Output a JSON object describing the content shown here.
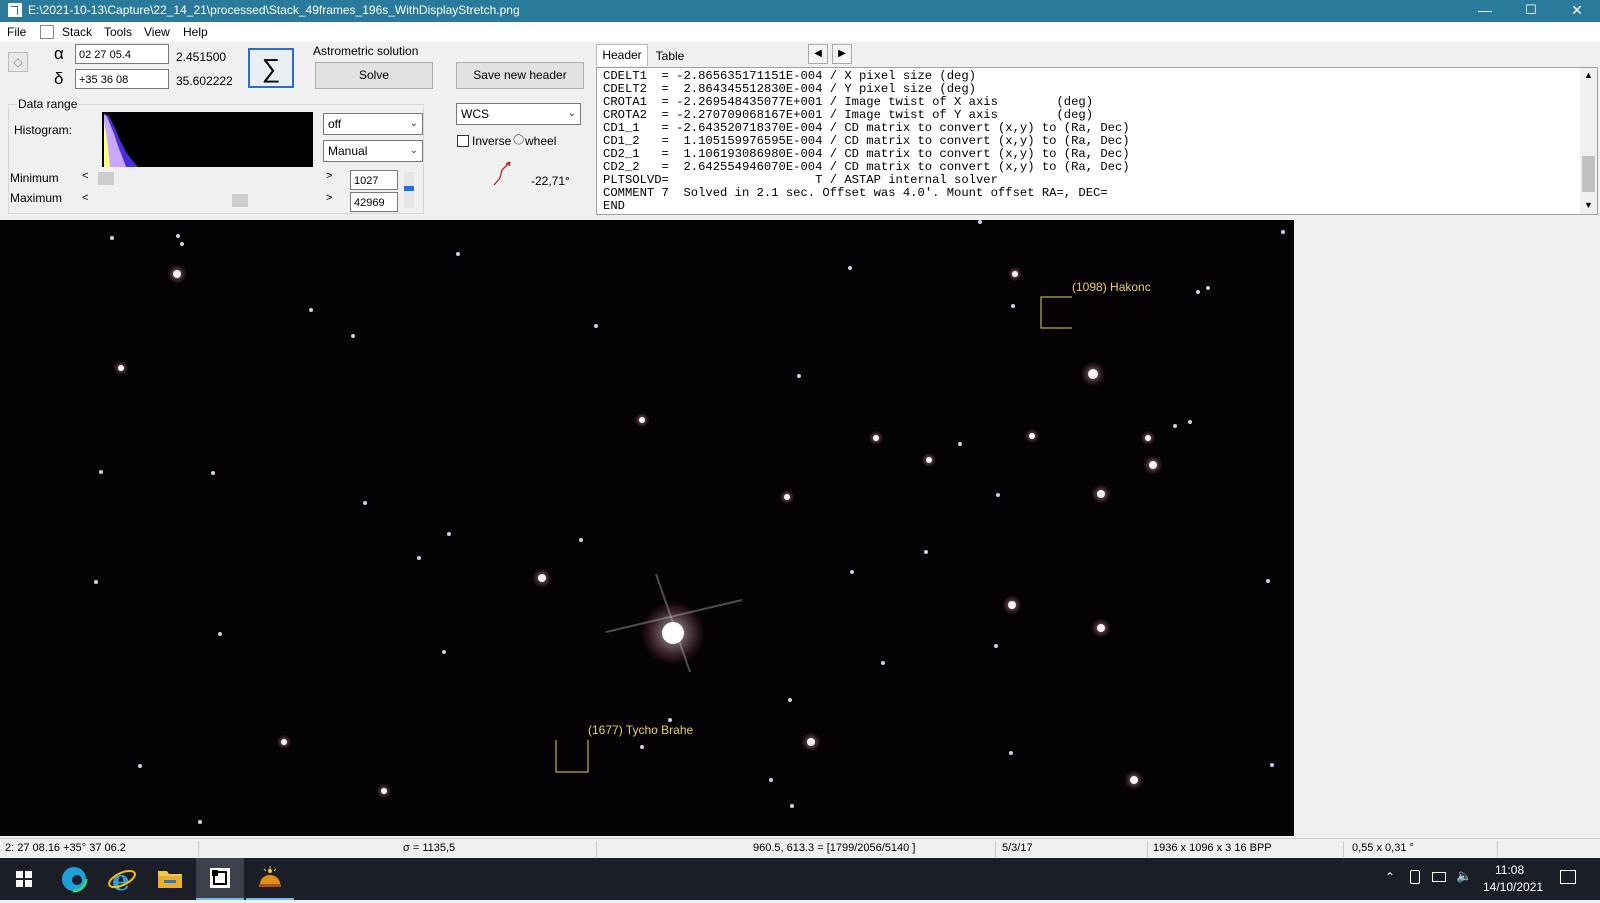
{
  "window": {
    "title": "E:\\2021-10-13\\Capture\\22_14_21\\processed\\Stack_49frames_196s_WithDisplayStretch.png",
    "minimize_glyph": "—",
    "maximize_glyph": "☐",
    "close_glyph": "✕"
  },
  "menu": {
    "file": "File",
    "stack": "Stack",
    "tools": "Tools",
    "view": "View",
    "help": "Help"
  },
  "coords": {
    "alpha_symbol": "α",
    "alpha_value": "02 27 05.4",
    "alpha_decimal": "2.451500",
    "delta_symbol": "δ",
    "delta_value": "+35 36 08",
    "delta_decimal": "35.602222",
    "sum_symbol": "∑"
  },
  "astrometric": {
    "label": "Astrometric solution",
    "solve": "Solve",
    "save_header": "Save new header"
  },
  "data_range": {
    "label": "Data range",
    "histogram_label": "Histogram:",
    "minimum_label": "Minimum",
    "maximum_label": "Maximum",
    "minimum_value": "1027",
    "maximum_value": "42969",
    "stretch": "off",
    "range_mode": "Manual"
  },
  "wcs": {
    "mode": "WCS",
    "inverse_label": "Inverse",
    "wheel_label": "wheel",
    "angle": "-22,71°"
  },
  "tabs": {
    "header": "Header",
    "table": "Table"
  },
  "header_lines": [
    "CDELT1  = -2.865635171151E-004 / X pixel size (deg)",
    "CDELT2  =  2.864345512830E-004 / Y pixel size (deg)",
    "CROTA1  = -2.269548435077E+001 / Image twist of X axis        (deg)",
    "CROTA2  = -2.270709068167E+001 / Image twist of Y axis        (deg)",
    "CD1_1   = -2.643520718370E-004 / CD matrix to convert (x,y) to (Ra, Dec)",
    "CD1_2   =  1.105159976595E-004 / CD matrix to convert (x,y) to (Ra, Dec)",
    "CD2_1   =  1.106193086980E-004 / CD matrix to convert (x,y) to (Ra, Dec)",
    "CD2_2   =  2.642554946070E-004 / CD matrix to convert (x,y) to (Ra, Dec)",
    "PLTSOLVD=                    T / ASTAP internal solver",
    "COMMENT 7  Solved in 2.1 sec. Offset was 4.0'. Mount offset RA=, DEC=",
    "END"
  ],
  "annotations": {
    "asteroid1": "(1098) Hakonc",
    "asteroid2": "(1677) Tycho Brahe"
  },
  "status": {
    "position": "2: 27 08.16  +35° 37 06.2",
    "sigma": "σ = 1135,5",
    "pixel": "960.5, 613.3 = [1799/2056/5140 ]",
    "ratio": "5/3/17",
    "dimensions": "1936 x 1096 x 3   16 BPP",
    "fov": "0,55 x 0,31 °"
  },
  "taskbar": {
    "time": "11:08",
    "date": "14/10/2021"
  },
  "colors": {
    "titlebar": "#2a7b9b",
    "annotation": "#e8d060",
    "sky": "#050306"
  }
}
